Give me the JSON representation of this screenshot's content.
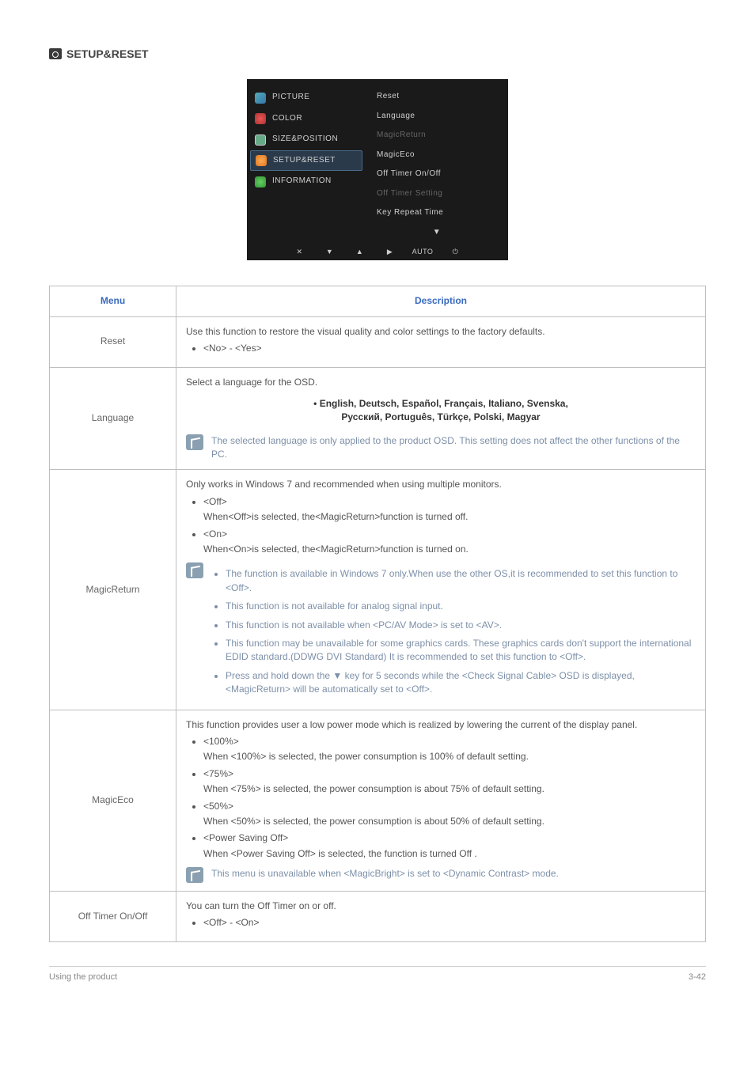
{
  "section": {
    "title": "SETUP&RESET"
  },
  "osd": {
    "left": [
      {
        "label": "PICTURE"
      },
      {
        "label": "COLOR"
      },
      {
        "label": "SIZE&POSITION"
      },
      {
        "label": "SETUP&RESET",
        "selected": true
      },
      {
        "label": "INFORMATION"
      }
    ],
    "right": [
      {
        "label": "Reset"
      },
      {
        "label": "Language"
      },
      {
        "label": "MagicReturn",
        "dim": true
      },
      {
        "label": "MagicEco"
      },
      {
        "label": "Off Timer On/Off"
      },
      {
        "label": "Off Timer Setting",
        "dim": true
      },
      {
        "label": "Key Repeat Time"
      }
    ],
    "footer": [
      "✕",
      "▼",
      "▲",
      "▶",
      "AUTO",
      "⏻"
    ]
  },
  "table": {
    "headers": [
      "Menu",
      "Description"
    ],
    "rows": {
      "reset": {
        "menu": "Reset",
        "intro": "Use this function to restore the visual quality and color settings to the factory defaults.",
        "opts": "<No> - <Yes>"
      },
      "language": {
        "menu": "Language",
        "intro": "Select a language for the OSD.",
        "langs1": "• English, Deutsch, Español, Français, Italiano, Svenska,",
        "langs2": "Русский, Português, Türkçe, Polski, Magyar",
        "note": "The selected language is only applied to the product OSD. This setting does not affect the other functions of the PC."
      },
      "magicreturn": {
        "menu": "MagicReturn",
        "intro": "Only works in Windows 7 and recommended when using multiple monitors.",
        "off_label": "<Off>",
        "off_text": "When<Off>is selected, the<MagicReturn>function is turned off.",
        "on_label": "<On>",
        "on_text": "When<On>is selected, the<MagicReturn>function is turned on.",
        "notes": [
          "The function is available in Windows 7 only.When use the other OS,it is recommended to set this function to <Off>.",
          "This function is not available for analog signal input.",
          "This function is not available when <PC/AV Mode> is set to <AV>.",
          "This function may be unavailable for some graphics cards. These graphics cards don't support the international EDID standard.(DDWG DVI Standard) It is recommended to set this function to <Off>.",
          "Press and hold down the ▼ key for 5 seconds while the <Check Signal Cable> OSD is displayed,<MagicReturn> will be automatically set to <Off>."
        ]
      },
      "magiceco": {
        "menu": "MagicEco",
        "intro": "This function provides user a low power mode which is realized by lowering the current of the display panel.",
        "p100_label": "<100%>",
        "p100_text": "When <100%> is selected, the power consumption is 100% of default setting.",
        "p75_label": "<75%>",
        "p75_text": "When <75%> is selected, the power consumption is about 75% of default setting.",
        "p50_label": "<50%>",
        "p50_text": "When <50%> is selected, the power consumption is about 50% of default setting.",
        "psoff_label": "<Power Saving Off>",
        "psoff_text": "When <Power Saving Off> is selected, the function is turned Off .",
        "note": "This menu is unavailable when <MagicBright> is set to <Dynamic Contrast> mode."
      },
      "offtimer": {
        "menu": "Off Timer On/Off",
        "intro": "You can turn the Off Timer on or off.",
        "opts": "<Off> - <On>"
      }
    }
  },
  "footer": {
    "left": "Using the product",
    "right": "3-42"
  }
}
